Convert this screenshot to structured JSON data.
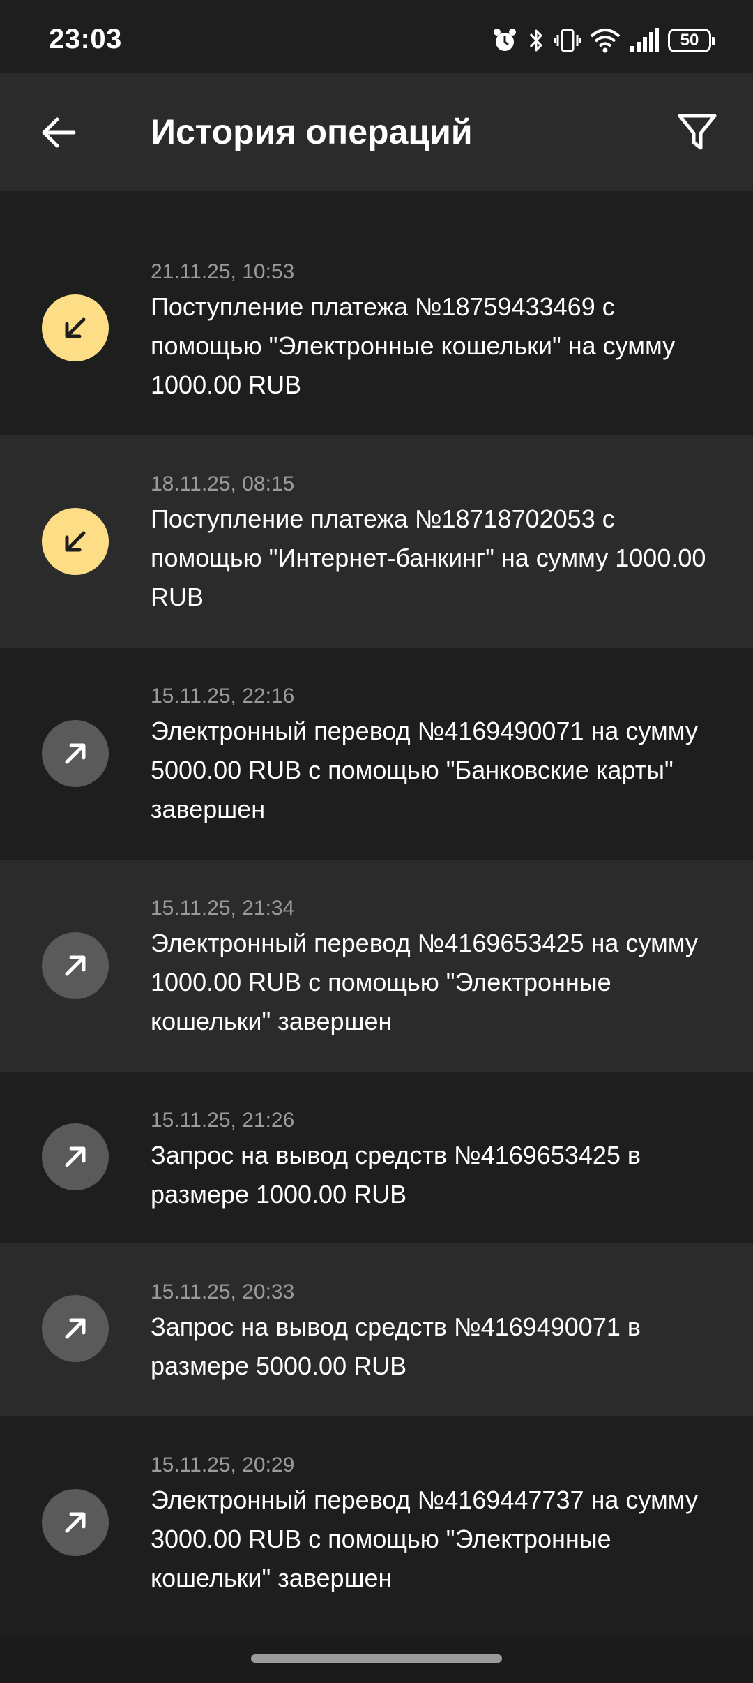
{
  "status_bar": {
    "time": "23:03",
    "battery": "50"
  },
  "app_bar": {
    "title": "История операций"
  },
  "operations": [
    {
      "direction": "in",
      "icon": "arrow-down-left-icon",
      "date": "21.11.25, 10:53",
      "text": "Поступление платежа №18759433469 с помощью \"Электронные кошельки\" на сумму 1000.00 RUB"
    },
    {
      "direction": "in",
      "icon": "arrow-down-left-icon",
      "date": "18.11.25, 08:15",
      "text": "Поступление платежа №18718702053 с помощью \"Интернет-банкинг\" на сумму 1000.00 RUB"
    },
    {
      "direction": "out",
      "icon": "arrow-up-right-icon",
      "date": "15.11.25, 22:16",
      "text": "Электронный перевод №4169490071 на сумму 5000.00 RUB с помощью \"Банковские карты\" завершен"
    },
    {
      "direction": "out",
      "icon": "arrow-up-right-icon",
      "date": "15.11.25, 21:34",
      "text": "Электронный перевод №4169653425 на сумму 1000.00 RUB с помощью \"Электронные кошельки\" завершен"
    },
    {
      "direction": "out",
      "icon": "arrow-up-right-icon",
      "date": "15.11.25, 21:26",
      "text": "Запрос на вывод средств №4169653425 в размере 1000.00 RUB"
    },
    {
      "direction": "out",
      "icon": "arrow-up-right-icon",
      "date": "15.11.25, 20:33",
      "text": "Запрос на вывод средств №4169490071 в размере 5000.00 RUB"
    },
    {
      "direction": "out",
      "icon": "arrow-up-right-icon",
      "date": "15.11.25, 20:29",
      "text": "Электронный перевод №4169447737 на сумму 3000.00 RUB с помощью \"Электронные кошельки\" завершен"
    }
  ],
  "colors": {
    "background": "#1e1e1e",
    "row_alt": "#2b2b2b",
    "incoming_accent": "#fdde86",
    "outgoing_icon": "#5a5a5a",
    "date_text": "#9a9a9a"
  }
}
